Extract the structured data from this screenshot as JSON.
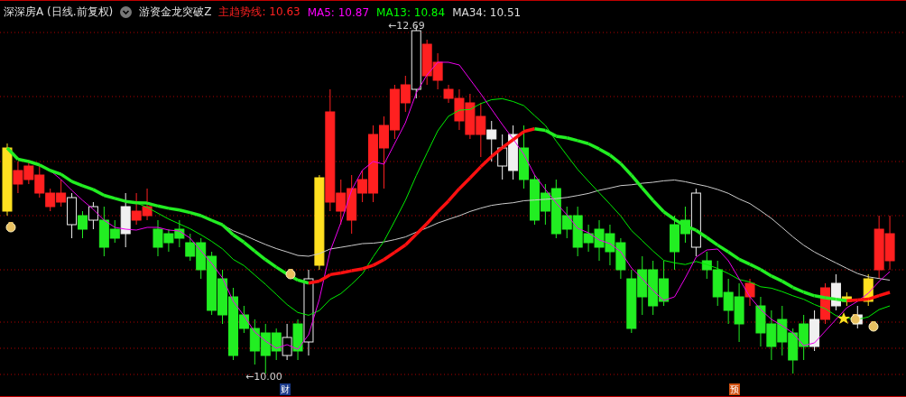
{
  "header": {
    "title": "深深房A (日线.前复权)",
    "indicator": "游资金龙突破Z",
    "legend": [
      {
        "text": "主趋势线: 10.63",
        "color": "#ff2020"
      },
      {
        "text": "MA5: 10.87",
        "color": "#ff00ff"
      },
      {
        "text": "MA13: 10.84",
        "color": "#00ff00"
      },
      {
        "text": "MA34: 10.51",
        "color": "#dddddd"
      }
    ]
  },
  "chart": {
    "high_label": "←12.69",
    "low_label": "←10.00",
    "markers": [
      {
        "text": "财",
        "color": "#1a3a8a"
      },
      {
        "text": "预",
        "color": "#d05010"
      }
    ]
  }
}
